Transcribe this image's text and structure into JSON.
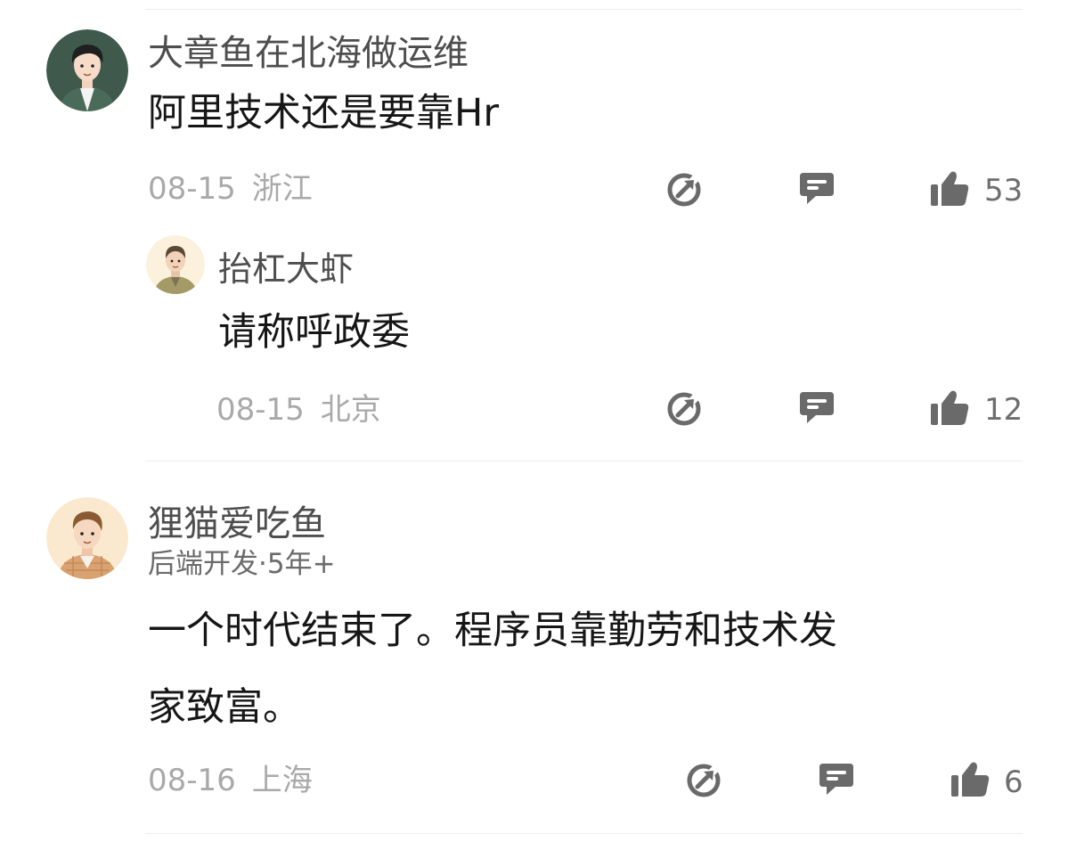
{
  "comments": [
    {
      "author": "大章鱼在北海做运维",
      "text": "阿里技术还是要靠Hr",
      "date": "08-15",
      "location": "浙江",
      "likes": "53",
      "avatar_icon": "avatar-dark-hair-man",
      "reply": {
        "author": "抬杠大虾",
        "text": "请称呼政委",
        "date": "08-15",
        "location": "北京",
        "likes": "12",
        "avatar_icon": "avatar-soldier"
      }
    },
    {
      "author": "狸猫爱吃鱼",
      "tag": "后端开发·5年+",
      "text_line1": "一个时代结束了。程序员靠勤劳和技术发",
      "text_line2": "家致富。",
      "date": "08-16",
      "location": "上海",
      "likes": "6",
      "avatar_icon": "avatar-brown-hair-man"
    }
  ],
  "icons": {
    "share": "share-icon",
    "reply": "comment-icon",
    "like": "thumbs-up-icon"
  },
  "colors": {
    "icon": "#6a6a6a",
    "name": "#4e4e4e",
    "meta": "#a9a9a9",
    "content": "#161616"
  }
}
